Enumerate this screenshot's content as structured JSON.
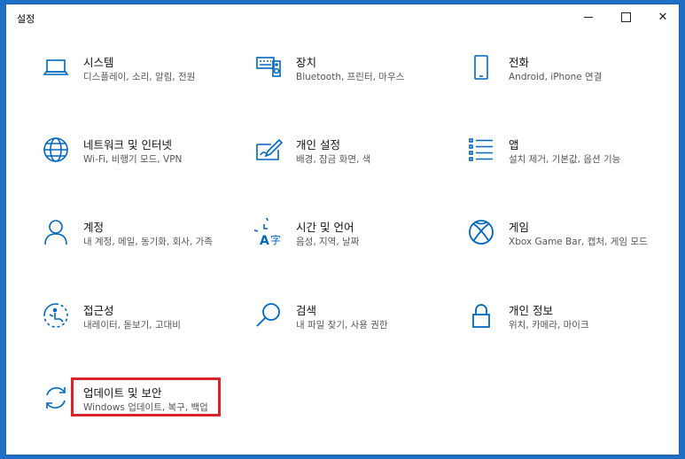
{
  "window": {
    "title": "설정"
  },
  "colors": {
    "accent": "#0067c0",
    "highlight": "#d9232a"
  },
  "tiles": [
    {
      "name": "시스템",
      "desc": "디스플레이, 소리, 알림, 전원",
      "icon": "laptop-icon"
    },
    {
      "name": "장치",
      "desc": "Bluetooth, 프린터, 마우스",
      "icon": "keyboard-speaker-icon"
    },
    {
      "name": "전화",
      "desc": "Android, iPhone 연결",
      "icon": "phone-icon"
    },
    {
      "name": "네트워크 및 인터넷",
      "desc": "Wi-Fi, 비행기 모드, VPN",
      "icon": "globe-icon"
    },
    {
      "name": "개인 설정",
      "desc": "배경, 잠금 화면, 색",
      "icon": "paint-icon"
    },
    {
      "name": "앱",
      "desc": "설치 제거, 기본값, 옵션 기능",
      "icon": "apps-list-icon"
    },
    {
      "name": "계정",
      "desc": "내 계정, 메일, 동기화, 회사, 가족",
      "icon": "person-icon"
    },
    {
      "name": "시간 및 언어",
      "desc": "음성, 지역, 날짜",
      "icon": "time-language-icon"
    },
    {
      "name": "게임",
      "desc": "Xbox Game Bar, 캡처, 게임 모드",
      "icon": "xbox-icon"
    },
    {
      "name": "접근성",
      "desc": "내레이터, 돋보기, 고대비",
      "icon": "ease-of-access-icon"
    },
    {
      "name": "검색",
      "desc": "내 파일 찾기, 사용 권한",
      "icon": "search-icon"
    },
    {
      "name": "개인 정보",
      "desc": "위치, 카메라, 마이크",
      "icon": "lock-icon"
    },
    {
      "name": "업데이트 및 보안",
      "desc": "Windows 업데이트, 복구, 백업",
      "icon": "sync-icon"
    }
  ]
}
